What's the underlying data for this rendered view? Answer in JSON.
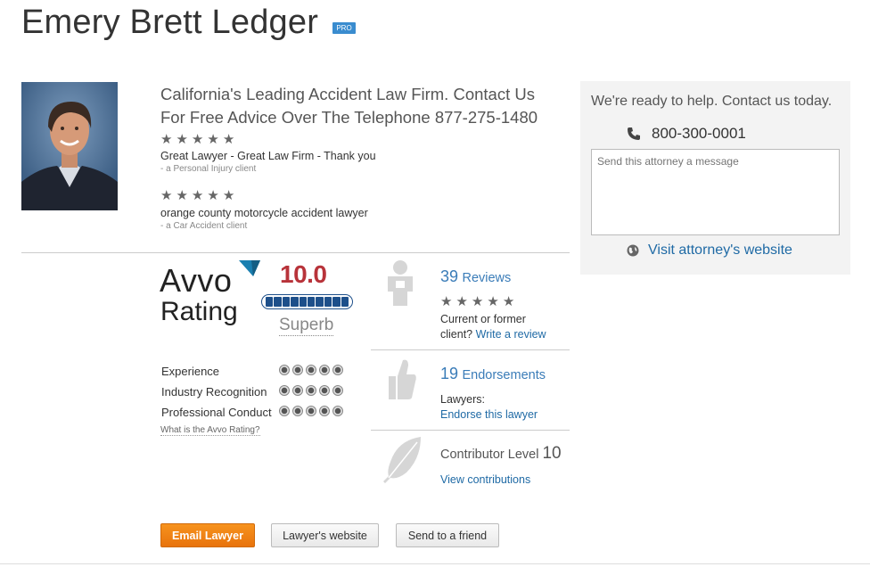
{
  "profile": {
    "name": "Emery Brett Ledger",
    "badge": "PRO",
    "headline": "California's Leading Accident Law Firm. Contact Us For Free Advice Over The Telephone 877-275-1480",
    "reviews": [
      {
        "stars": 5,
        "text": "Great Lawyer - Great Law Firm - Thank you",
        "source": "- a Personal Injury client"
      },
      {
        "stars": 5,
        "text": "orange county motorcycle accident lawyer",
        "source": "- a Car Accident client"
      }
    ]
  },
  "rating": {
    "logo_top": "Avvo",
    "logo_bottom": "Rating",
    "score": "10.0",
    "score_fraction": 1.0,
    "label": "Superb",
    "categories": [
      {
        "name": "Experience",
        "dots": 5
      },
      {
        "name": "Industry Recognition",
        "dots": 5
      },
      {
        "name": "Professional Conduct",
        "dots": 5
      }
    ],
    "what_is_link": "What is the Avvo Rating?"
  },
  "stats": {
    "reviews_count": "39",
    "reviews_label": "Reviews",
    "reviews_stars": 5,
    "reviews_line1": "Current or former",
    "reviews_line2_prefix": "client?",
    "reviews_cta": "Write a review",
    "endorse_count": "19",
    "endorse_label": "Endorsements",
    "endorse_line1": "Lawyers:",
    "endorse_cta": "Endorse this lawyer",
    "contrib_label": "Contributor Level",
    "contrib_level": "10",
    "contrib_cta": "View contributions"
  },
  "contact": {
    "ready": "We're ready to help. Contact us today.",
    "phone": "800-300-0001",
    "message_placeholder": "Send this attorney a message",
    "visit": "Visit attorney's website"
  },
  "buttons": {
    "email": "Email Lawyer",
    "website": "Lawyer's website",
    "send": "Send to a friend"
  },
  "colors": {
    "accent_orange": "#f7931e",
    "link_blue": "#1f6aa5",
    "score_red": "#b8333a",
    "bar_blue": "#1d4f8a",
    "logo_teal": "#1a7fb0"
  },
  "icons": [
    "star-icon",
    "phone-icon",
    "globe-icon",
    "reviewer-icon",
    "thumbs-up-icon",
    "feather-icon"
  ]
}
